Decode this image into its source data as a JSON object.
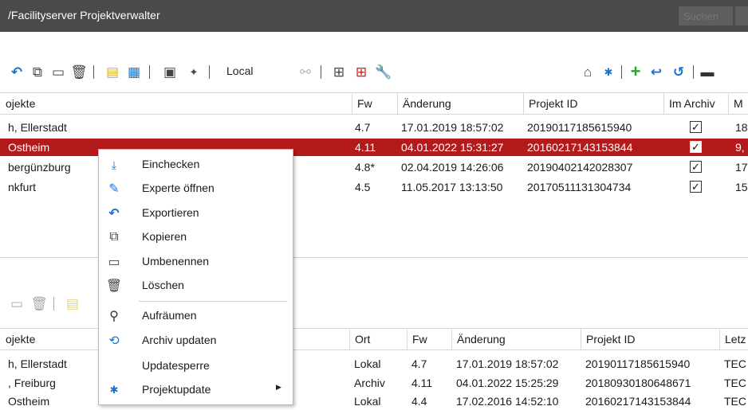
{
  "window": {
    "title": "/Facilityserver Projektverwalter",
    "search_placeholder": "Suchen"
  },
  "toolbar_top": {
    "local_label": "Local"
  },
  "projects_table": {
    "columns": [
      "ojekte",
      "Fw",
      "Änderung",
      "Projekt ID",
      "Im Archiv",
      "M"
    ],
    "rows": [
      {
        "name": "h, Ellerstadt",
        "fw": "4.7",
        "changed": "17.01.2019 18:57:02",
        "id": "20190117185615940",
        "archived": true,
        "m": "18",
        "selected": false
      },
      {
        "name": " Ostheim",
        "fw": "4.11",
        "changed": "04.01.2022 15:31:27",
        "id": "20160217143153844",
        "archived": true,
        "m": "9,",
        "selected": true
      },
      {
        "name": "bergünzburg",
        "fw": "4.8*",
        "changed": "02.04.2019 14:26:06",
        "id": "20190402142028307",
        "archived": true,
        "m": "17",
        "selected": false
      },
      {
        "name": "nkfurt",
        "fw": "4.5",
        "changed": "11.05.2017 13:13:50",
        "id": "20170511131304734",
        "archived": true,
        "m": "15",
        "selected": false
      }
    ]
  },
  "archive_table": {
    "columns": [
      "ojekte",
      "Ort",
      "Fw",
      "Änderung",
      "Projekt ID",
      "Letz"
    ],
    "rows": [
      {
        "name": "h, Ellerstadt",
        "ort": "Lokal",
        "fw": "4.7",
        "changed": "17.01.2019 18:57:02",
        "id": "20190117185615940",
        "last": "TEC"
      },
      {
        "name": ", Freiburg",
        "ort": "Archiv",
        "fw": "4.11",
        "changed": "04.01.2022 15:25:29",
        "id": "20180930180648671",
        "last": "TEC"
      },
      {
        "name": " Ostheim",
        "ort": "Lokal",
        "fw": "4.4",
        "changed": "17.02.2016 14:52:10",
        "id": "20160217143153844",
        "last": "TEC"
      }
    ]
  },
  "context_menu": {
    "items": [
      {
        "label": "Einchecken",
        "icon": "checkin-icon"
      },
      {
        "label": "Experte öffnen",
        "icon": "pencil-icon"
      },
      {
        "label": "Exportieren",
        "icon": "export-icon"
      },
      {
        "label": "Kopieren",
        "icon": "copy-icon"
      },
      {
        "label": "Umbenennen",
        "icon": "rename-icon"
      },
      {
        "label": "Löschen",
        "icon": "trash-icon"
      },
      {
        "label": "Aufräumen",
        "icon": "broom-icon"
      },
      {
        "label": "Archiv updaten",
        "icon": "archive-update-icon"
      },
      {
        "label": "Updatesperre",
        "icon": ""
      },
      {
        "label": "Projektupdate",
        "icon": "project-update-icon",
        "has_submenu": true
      }
    ]
  },
  "colors": {
    "titlebar": "#4a4a4a",
    "selection": "#b31b1b",
    "accent_blue": "#1a73c9",
    "accent_green": "#2aa52a",
    "accent_red": "#d11a1a",
    "accent_yellow": "#e0b400"
  }
}
